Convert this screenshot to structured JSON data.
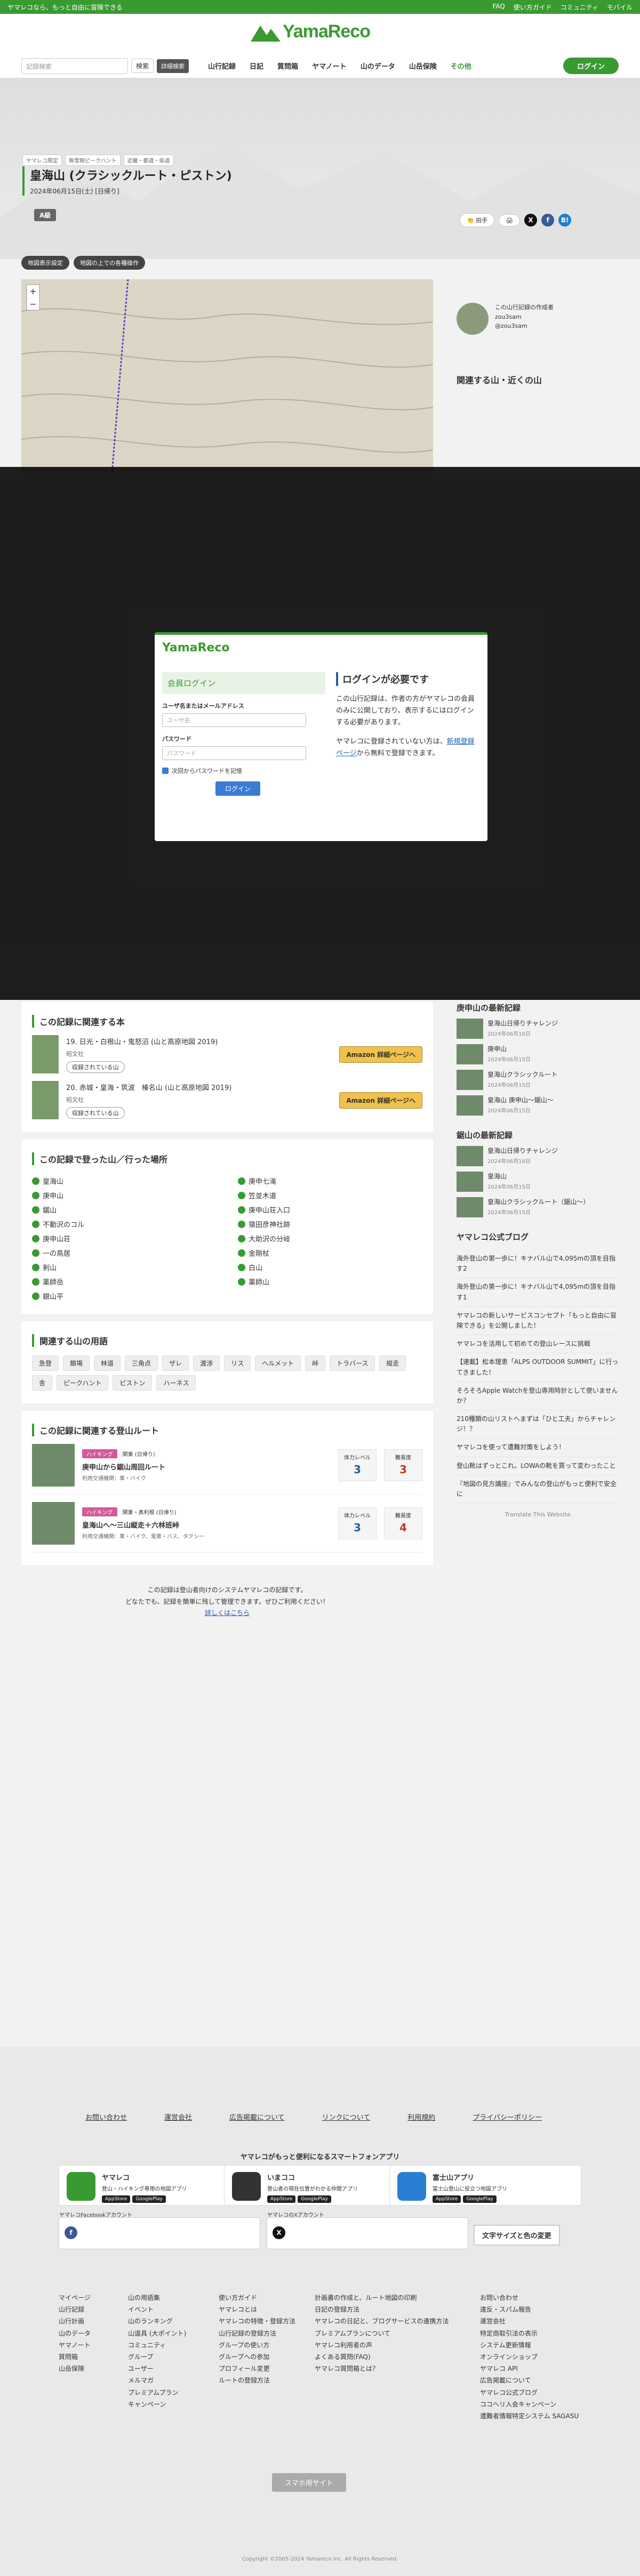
{
  "topbar": {
    "tagline": "ヤマレコなら、もっと自由に冒険できる",
    "links": [
      "FAQ",
      "使い方ガイド",
      "コミュニティ",
      "モバイル"
    ]
  },
  "header": {
    "logo_text": "YamaReco",
    "search_placeholder": "記録検索",
    "search_label": "検索",
    "detail_label": "詳細検索",
    "menu": [
      "山行記録",
      "日記",
      "質問箱",
      "ヤマノート",
      "山のデータ",
      "山岳保険",
      "その他"
    ],
    "login_label": "ログイン"
  },
  "hero": {
    "breadcrumb": [
      "ヤマレコ限定",
      "無雪期ピークハント",
      "近畿・都道・県道"
    ],
    "title": "皇海山 (クラシックルート・ピストン)",
    "date": "2024年06月15日(土) [日帰り]",
    "grade": "A級",
    "actions": {
      "clap": "拍手",
      "print_icon": "printer-icon",
      "share": [
        "X",
        "f",
        "B!"
      ]
    }
  },
  "map": {
    "selectors": [
      "地図表示設定",
      "地図の上での各種操作"
    ]
  },
  "author": {
    "caption": "この山行記録の作成者",
    "name": "zou3sam",
    "handle": "@zou3sam"
  },
  "related_mtns_title": "関連する山・近くの山",
  "login_modal": {
    "logo": "YamaReco",
    "member_login": "会員ログイン",
    "user_label": "ユーザ名またはメールアドレス",
    "user_placeholder": "ユーザ名",
    "pass_label": "パスワード",
    "pass_placeholder": "パスワード",
    "remember": "次回からパスワードを記憶",
    "login": "ログイン",
    "need_title": "ログインが必要です",
    "need_text_1": "この山行記録は、作者の方がヤマレコの会員のみに公開しており、表示するにはログインする必要があります。",
    "need_text_2": "ヤマレコに登録されていない方は、",
    "need_link": "新規登録ページ",
    "need_text_3": "から無料で登録できます。"
  },
  "books": {
    "title": "この記録に関連する本",
    "items": [
      {
        "title": "19. 日光・白根山・鬼怒沼 (山と高原地図 2019)",
        "author": "昭文社",
        "lend": "収録されている山"
      },
      {
        "title": "20. 赤城・皇海・筑波　榛名山 (山と高原地図 2019)",
        "author": "昭文社",
        "lend": "収録されている山"
      }
    ],
    "amazon": "Amazon 詳細ページへ"
  },
  "places": {
    "title": "この記録で登った山／行った場所",
    "left": [
      "皇海山",
      "庚申山",
      "鋸山",
      "不動沢のコル",
      "庚申山荘",
      "一の鳥居",
      "剣山",
      "薬師岳",
      "銀山平"
    ],
    "right": [
      "庚申七滝",
      "笠並木道",
      "庚申山荘入口",
      "猿田彦神社跡",
      "大助沢の分岐",
      "金剛杖",
      "白山",
      "薬師山"
    ]
  },
  "terms": {
    "title": "関連する山の用語",
    "tags": [
      "急登",
      "鎖場",
      "林道",
      "三角点",
      "ザレ",
      "渡渉",
      "リス",
      "ヘルメット",
      "峠",
      "トラバース",
      "縦走",
      "舎",
      "ピークハント",
      "ピストン",
      "ハーネス"
    ]
  },
  "routes": {
    "title": "この記録に関連する登山ルート",
    "items": [
      {
        "tag": "ハイキング",
        "region": "関東 (日帰り)",
        "name": "庚申山から鋸山周回ルート",
        "meta": "利用交通機関：車・バイク",
        "phys_label": "体力レベル",
        "phys": "3",
        "tech_label": "難易度",
        "tech": "3"
      },
      {
        "tag": "ハイキング",
        "region": "関東・奥利根 (日帰り)",
        "name": "皇海山へ〜三山縦走＋六林班峠",
        "meta": "利用交通機関：車・バイク、電車・バス、タクシー",
        "phys_label": "体力レベル",
        "phys": "3",
        "tech_label": "難易度",
        "tech": "4"
      }
    ]
  },
  "notice": {
    "line1": "この記録は登山者向けのシステムヤマレコの記録です。",
    "line2": "どなたでも、記録を簡単に残して管理できます。ぜひご利用ください！",
    "link": "詳しくはこちら"
  },
  "sidebar": {
    "latest_title": "庚申山の最新記録",
    "latest_items": [
      {
        "title": "皇海山日帰りチャレンジ",
        "date": "2024年06月16日"
      },
      {
        "title": "庚申山",
        "date": "2024年06月15日"
      },
      {
        "title": "皇海山クラシックルート",
        "date": "2024年06月15日"
      },
      {
        "title": "皇海山 庚申山〜鋸山〜",
        "date": "2024年06月15日"
      }
    ],
    "latest2_title": "鋸山の最新記録",
    "latest2_items": [
      {
        "title": "皇海山日帰りチャレンジ",
        "date": "2024年06月16日"
      },
      {
        "title": "皇海山",
        "date": "2024年06月15日"
      },
      {
        "title": "皇海山クラシックルート（鋸山〜）",
        "date": "2024年06月15日"
      }
    ],
    "blog_title": "ヤマレコ公式ブログ",
    "blog_items": [
      "海外登山の第一歩に！キナバル山で4,095mの頂を目指す2",
      "海外登山の第一歩に！キナバル山で4,095mの頂を目指す1",
      "ヤマレコの新しいサービスコンセプト「もっと自由に冒険できる」を公開しました！",
      "ヤマレコを活用して初めての登山レースに挑戦",
      "【連載】松本理恵「ALPS OUTDOOR SUMMIT」に行ってきました！",
      "そろそろApple Watchを登山専用時計として使いませんか？",
      "210種類の山リストへまずは「ひと工夫」からチャレンジ！？",
      "ヤマレコを使って遭難対策をしよう！",
      "登山靴はずっとこれ。LOWAの靴を買って変わったこと",
      "『地図の見方講座』でみんなの登山がもっと便利で安全に"
    ],
    "translate": "Translate This Website"
  },
  "footer": {
    "links": [
      "お問い合わせ",
      "運営会社",
      "広告掲載について",
      "リンクについて",
      "利用規約",
      "プライバシーポリシー"
    ],
    "apps_title": "ヤマレコがもっと便利になるスマートフォンアプリ",
    "apps": [
      {
        "name": "ヤマレコ",
        "desc": "登山・ハイキング専用の地図アプリ"
      },
      {
        "name": "いまココ",
        "desc": "登山者の現在位置がわかる仲間アプリ"
      },
      {
        "name": "富士山アプリ",
        "desc": "富士山登山に役立つ地図アプリ"
      }
    ],
    "store_labels": [
      "AppStore",
      "GooglePlay"
    ],
    "fb_label": "ヤマレコFacebookアカウント",
    "x_label": "ヤマレコのXアカウント",
    "font_btn": "文字サイズと色の変更",
    "col1": [
      "マイページ",
      "山行記録",
      "山行計画",
      "山のデータ",
      "ヤマノート",
      "質問箱",
      "山岳保険"
    ],
    "col2": [
      "山の用語集",
      "イベント",
      "山のランキング",
      "山道具 (大ポイント)",
      "コミュニティ",
      "グループ",
      "ユーザー",
      "メルマガ",
      "プレミアムプラン",
      "キャンペーン"
    ],
    "col3": [
      "使い方ガイド",
      "ヤマレコとは",
      "ヤマレコの特徴・登録方法",
      "山行記録の登録方法",
      "グループの使い方",
      "グループへの参加",
      "プロフィール変更",
      "ルートの登録方法"
    ],
    "col4": [
      "計画書の作成と、ルート地図の印刷",
      "日記の登録方法",
      "ヤマレコの日記と、ブログサービスの連携方法",
      "プレミアムプランについて",
      "ヤマレコ利用者の声",
      "よくある質問(FAQ)",
      "ヤマレコ質問箱とは？"
    ],
    "col5": [
      "お問い合わせ",
      "違反・スパム報告",
      "運営会社",
      "特定商取引法の表示",
      "システム更新情報",
      "オンラインショップ",
      "ヤマレコ API",
      "広告掲載について",
      "ヤマレコ公式ブログ",
      "ココヘリ入会キャンペーン",
      "遭難者情報特定システム SAGASU"
    ],
    "pc_btn": "スマホ用サイト",
    "copyright": "Copyright ©2005-2024 Yamareco Inc. All Rights Reserved."
  }
}
